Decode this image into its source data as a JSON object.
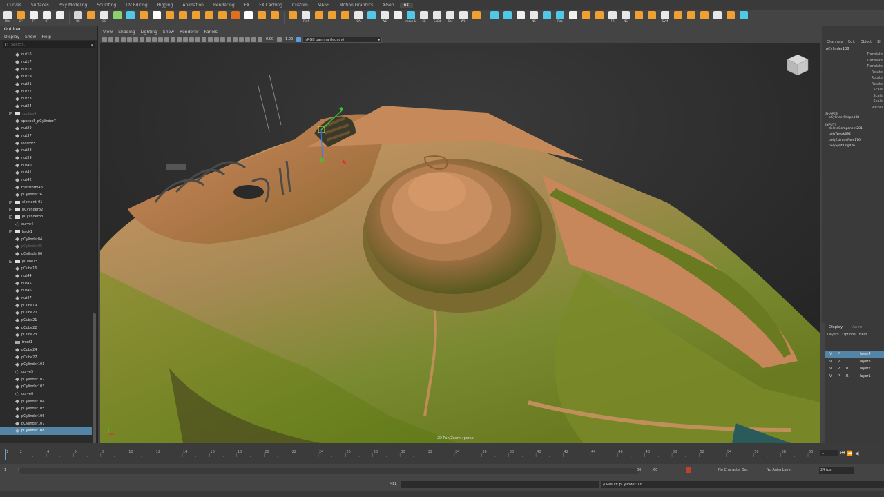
{
  "shelf_tabs": [
    "Curves",
    "Surfaces",
    "Poly Modeling",
    "Sculpting",
    "UV Editing",
    "Rigging",
    "Animation",
    "Rendering",
    "FX",
    "FX Caching",
    "Custom",
    "MASH",
    "Motion Graphics",
    "XGen",
    "nK"
  ],
  "active_shelf_tab": "nK",
  "shelf_buttons": [
    {
      "label": "Mirr",
      "color": "#e8e8e8"
    },
    {
      "label": "CP",
      "color": "#f0a030"
    },
    {
      "label": "FT",
      "color": "#f0f0f0"
    },
    {
      "label": "RT",
      "color": "#f0f0f0"
    },
    {
      "label": "",
      "color": "#f0f0f0"
    },
    {
      "label": "BS",
      "color": "#d8d8d8"
    },
    {
      "label": "",
      "color": "#f0a030"
    },
    {
      "label": "GE",
      "color": "#e8e8e8"
    },
    {
      "label": "",
      "color": "#8cd070"
    },
    {
      "label": "",
      "color": "#50c8e8"
    },
    {
      "label": "",
      "color": "#f0a030"
    },
    {
      "label": "",
      "color": "#ffffff"
    },
    {
      "label": "",
      "color": "#f0a030"
    },
    {
      "label": "",
      "color": "#f0a030"
    },
    {
      "label": "",
      "color": "#f0a030"
    },
    {
      "label": "",
      "color": "#f0a030"
    },
    {
      "label": "",
      "color": "#f0a030"
    },
    {
      "label": "",
      "color": "#e07020"
    },
    {
      "label": "",
      "color": "#ffffff"
    },
    {
      "label": "",
      "color": "#f0a030"
    },
    {
      "label": "",
      "color": "#f0a030"
    },
    {
      "label": "",
      "color": "#f0a030"
    },
    {
      "label": "Pref",
      "color": "#e8e8e8"
    },
    {
      "label": "",
      "color": "#f0a030"
    },
    {
      "label": "",
      "color": "#f0a030"
    },
    {
      "label": "",
      "color": "#f0a030"
    },
    {
      "label": "SA",
      "color": "#e8e8e8"
    },
    {
      "label": "",
      "color": "#50c8e8"
    },
    {
      "label": "WC",
      "color": "#e8e8e8"
    },
    {
      "label": "",
      "color": "#f0f0f0"
    },
    {
      "label": "move U",
      "color": "#50c8e8"
    },
    {
      "label": "CE",
      "color": "#e8e8e8"
    },
    {
      "label": "CpEd",
      "color": "#e8e8e8"
    },
    {
      "label": "Set",
      "color": "#e8e8e8"
    },
    {
      "label": "WC",
      "color": "#e8e8e8"
    },
    {
      "label": "",
      "color": "#f0a030"
    },
    {
      "label": "",
      "color": "#50c8e8"
    },
    {
      "label": "",
      "color": "#50c8e8"
    },
    {
      "label": "",
      "color": "#f0f0f0"
    },
    {
      "label": "NE",
      "color": "#e8e8e8"
    },
    {
      "label": "",
      "color": "#50c8e8"
    },
    {
      "label": "Roo",
      "color": "#50c8e8"
    },
    {
      "label": "",
      "color": "#f0f0f0"
    },
    {
      "label": "",
      "color": "#f0a030"
    },
    {
      "label": "",
      "color": "#f0a030"
    },
    {
      "label": "FR",
      "color": "#e8e8e8"
    },
    {
      "label": "NS",
      "color": "#e8e8e8"
    },
    {
      "label": "",
      "color": "#f0a030"
    },
    {
      "label": "",
      "color": "#f0a030"
    },
    {
      "label": "SVM",
      "color": "#e8e8e8"
    },
    {
      "label": "",
      "color": "#f0a030"
    },
    {
      "label": "",
      "color": "#f0a030"
    },
    {
      "label": "",
      "color": "#f0a030"
    },
    {
      "label": "",
      "color": "#e8e8e8"
    },
    {
      "label": "",
      "color": "#f0a030"
    },
    {
      "label": "",
      "color": "#50c8e8"
    }
  ],
  "outliner": {
    "title": "Outliner",
    "menu": [
      "Display",
      "Show",
      "Help"
    ],
    "search_placeholder": "Search...",
    "items": [
      {
        "name": "nut16",
        "icon": "mesh"
      },
      {
        "name": "nut17",
        "icon": "mesh"
      },
      {
        "name": "nut18",
        "icon": "mesh"
      },
      {
        "name": "nut19",
        "icon": "mesh"
      },
      {
        "name": "nut21",
        "icon": "mesh"
      },
      {
        "name": "nut22",
        "icon": "mesh"
      },
      {
        "name": "nut23",
        "icon": "mesh"
      },
      {
        "name": "nut24",
        "icon": "mesh"
      },
      {
        "name": "spokes4",
        "icon": "group",
        "expand": true,
        "dim": true
      },
      {
        "name": "spokes5_pCylinder7",
        "icon": "mesh"
      },
      {
        "name": "nut29",
        "icon": "mesh"
      },
      {
        "name": "nut37",
        "icon": "mesh"
      },
      {
        "name": "locator5",
        "icon": "mesh"
      },
      {
        "name": "nut38",
        "icon": "mesh"
      },
      {
        "name": "nut39",
        "icon": "mesh"
      },
      {
        "name": "nut40",
        "icon": "mesh"
      },
      {
        "name": "nut41",
        "icon": "mesh"
      },
      {
        "name": "nut42",
        "icon": "mesh"
      },
      {
        "name": "transform48",
        "icon": "mesh"
      },
      {
        "name": "pCylinder76",
        "icon": "mesh"
      },
      {
        "name": "element_01",
        "icon": "group",
        "expand": true
      },
      {
        "name": "pCylinder82",
        "icon": "group",
        "expand": true
      },
      {
        "name": "pCylinder83",
        "icon": "group",
        "expand": true
      },
      {
        "name": "curve4",
        "icon": "curve"
      },
      {
        "name": "back1",
        "icon": "group",
        "expand": true
      },
      {
        "name": "pCylinder84",
        "icon": "mesh"
      },
      {
        "name": "pCylinder85",
        "icon": "mesh",
        "dim": true
      },
      {
        "name": "pCylinder86",
        "icon": "mesh"
      },
      {
        "name": "pCube15",
        "icon": "group",
        "expand": true
      },
      {
        "name": "pCube16",
        "icon": "mesh"
      },
      {
        "name": "nut44",
        "icon": "mesh"
      },
      {
        "name": "nut45",
        "icon": "mesh"
      },
      {
        "name": "nut46",
        "icon": "mesh"
      },
      {
        "name": "nut47",
        "icon": "mesh"
      },
      {
        "name": "pCube19",
        "icon": "mesh"
      },
      {
        "name": "pCube20",
        "icon": "mesh"
      },
      {
        "name": "pCube21",
        "icon": "mesh"
      },
      {
        "name": "pCube22",
        "icon": "mesh"
      },
      {
        "name": "pCube23",
        "icon": "mesh"
      },
      {
        "name": "front1",
        "icon": "cam"
      },
      {
        "name": "pCube24",
        "icon": "mesh"
      },
      {
        "name": "pCube27",
        "icon": "mesh"
      },
      {
        "name": "pCylinder101",
        "icon": "mesh"
      },
      {
        "name": "curve5",
        "icon": "curve"
      },
      {
        "name": "pCylinder102",
        "icon": "mesh"
      },
      {
        "name": "pCylinder103",
        "icon": "mesh"
      },
      {
        "name": "curve6",
        "icon": "curve"
      },
      {
        "name": "pCylinder104",
        "icon": "mesh"
      },
      {
        "name": "pCylinder105",
        "icon": "mesh"
      },
      {
        "name": "pCylinder106",
        "icon": "mesh"
      },
      {
        "name": "pCylinder107",
        "icon": "mesh"
      },
      {
        "name": "pCylinder108",
        "icon": "mesh",
        "selected": true
      }
    ]
  },
  "viewport": {
    "menu": [
      "View",
      "Shading",
      "Lighting",
      "Show",
      "Renderer",
      "Panels"
    ],
    "value1": "0.00",
    "value2": "1.00",
    "color_space": "sRGB gamma (legacy)",
    "label": "2D Pan/Zoom : persp"
  },
  "channel_box": {
    "menu": [
      "Channels",
      "Edit",
      "Object",
      "Sh"
    ],
    "object_name": "pCylinder108",
    "attributes": [
      "Translate",
      "Translate",
      "Translate",
      "Rotate",
      "Rotate",
      "Rotate",
      "Scale",
      "Scale",
      "Scale",
      "Visibili"
    ],
    "shapes_label": "SHAPES",
    "shape_name": "pCylinderShape108",
    "inputs_label": "INPUTS",
    "inputs": [
      "deleteComponent281",
      "polyTweak692",
      "polyExtrudeFace176",
      "polySplitRing476"
    ]
  },
  "layer_editor": {
    "tabs": [
      "Display",
      "Anim"
    ],
    "menu": [
      "Layers",
      "Options",
      "Help"
    ],
    "layers": [
      {
        "v": "V",
        "p": "P",
        "r": "",
        "name": "layer4",
        "selected": true
      },
      {
        "v": "V",
        "p": "P",
        "r": "",
        "name": "layer3"
      },
      {
        "v": "V",
        "p": "P",
        "r": "R",
        "name": "layer2"
      },
      {
        "v": "V",
        "p": "P",
        "r": "R",
        "name": "layer1"
      }
    ]
  },
  "timeline": {
    "ticks": [
      "1",
      "2",
      "4",
      "6",
      "8",
      "10",
      "12",
      "14",
      "16",
      "18",
      "20",
      "22",
      "24",
      "26",
      "28",
      "30",
      "32",
      "34",
      "36",
      "38",
      "40",
      "42",
      "44",
      "46",
      "48",
      "50",
      "52",
      "54",
      "56",
      "58",
      "60"
    ],
    "current_frame": "1"
  },
  "range_slider": {
    "start": "1",
    "start_inner": "1",
    "end_inner": "60",
    "end": "60",
    "character_set": "No Character Set",
    "anim_layer": "No Anim Layer",
    "fps": "24 fps"
  },
  "command_line": {
    "language": "MEL",
    "result": "// Result: pCylinder108"
  }
}
